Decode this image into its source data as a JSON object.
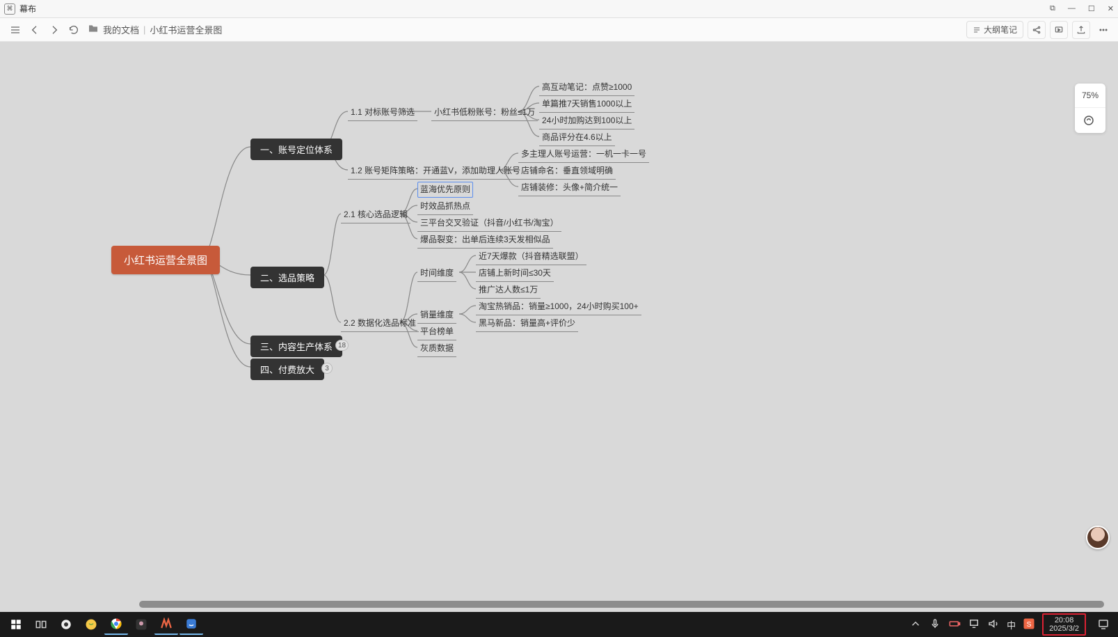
{
  "app": {
    "title": "幕布"
  },
  "win": {
    "min": "—",
    "max": "☐",
    "restore": "⧉",
    "close": "✕"
  },
  "toolbar": {
    "folder": "我的文档",
    "doc": "小红书运营全景图",
    "outline_btn": "大纲笔记"
  },
  "zoom": "75%",
  "mindmap": {
    "root": "小红书运营全景图",
    "b1": {
      "title": "一、账号定位体系",
      "n1_1": "1.1 对标账号筛选",
      "n1_1a": "小红书低粉账号：粉丝≤1万",
      "n1_1a_c": [
        "高互动笔记：点赞≥1000",
        "单篇推7天销售1000以上",
        "24小时加购达到100以上",
        "商品评分在4.6以上"
      ],
      "n1_2": "1.2 账号矩阵策略：开通蓝V，添加助理人账号",
      "n1_2_c": [
        "多主理人账号运营：一机一卡一号",
        "店铺命名：垂直领域明确",
        "店铺装修：头像+简介统一"
      ]
    },
    "b2": {
      "title": "二、选品策略",
      "n2_1": "2.1 核心选品逻辑",
      "n2_1_c": [
        "蓝海优先原则",
        "时效品抓热点",
        "三平台交叉验证（抖音/小红书/淘宝）",
        "爆品裂变：出单后连续3天发相似品"
      ],
      "n2_2": "2.2 数据化选品标准",
      "n2_2_dims": [
        "时间维度",
        "销量维度",
        "平台榜单",
        "灰质数据"
      ],
      "n2_2_time": [
        "近7天爆款（抖音精选联盟）",
        "店铺上新时间≤30天",
        "推广达人数≤1万"
      ],
      "n2_2_sales": [
        "淘宝热销品：销量≥1000，24小时购买100+",
        "黑马新品：销量高+评价少"
      ]
    },
    "b3": {
      "title": "三、内容生产体系",
      "badge": "18"
    },
    "b4": {
      "title": "四、付费放大",
      "badge": "3"
    }
  },
  "taskbar": {
    "time": "20:08",
    "date": "2025/3/2",
    "ime": "中"
  }
}
